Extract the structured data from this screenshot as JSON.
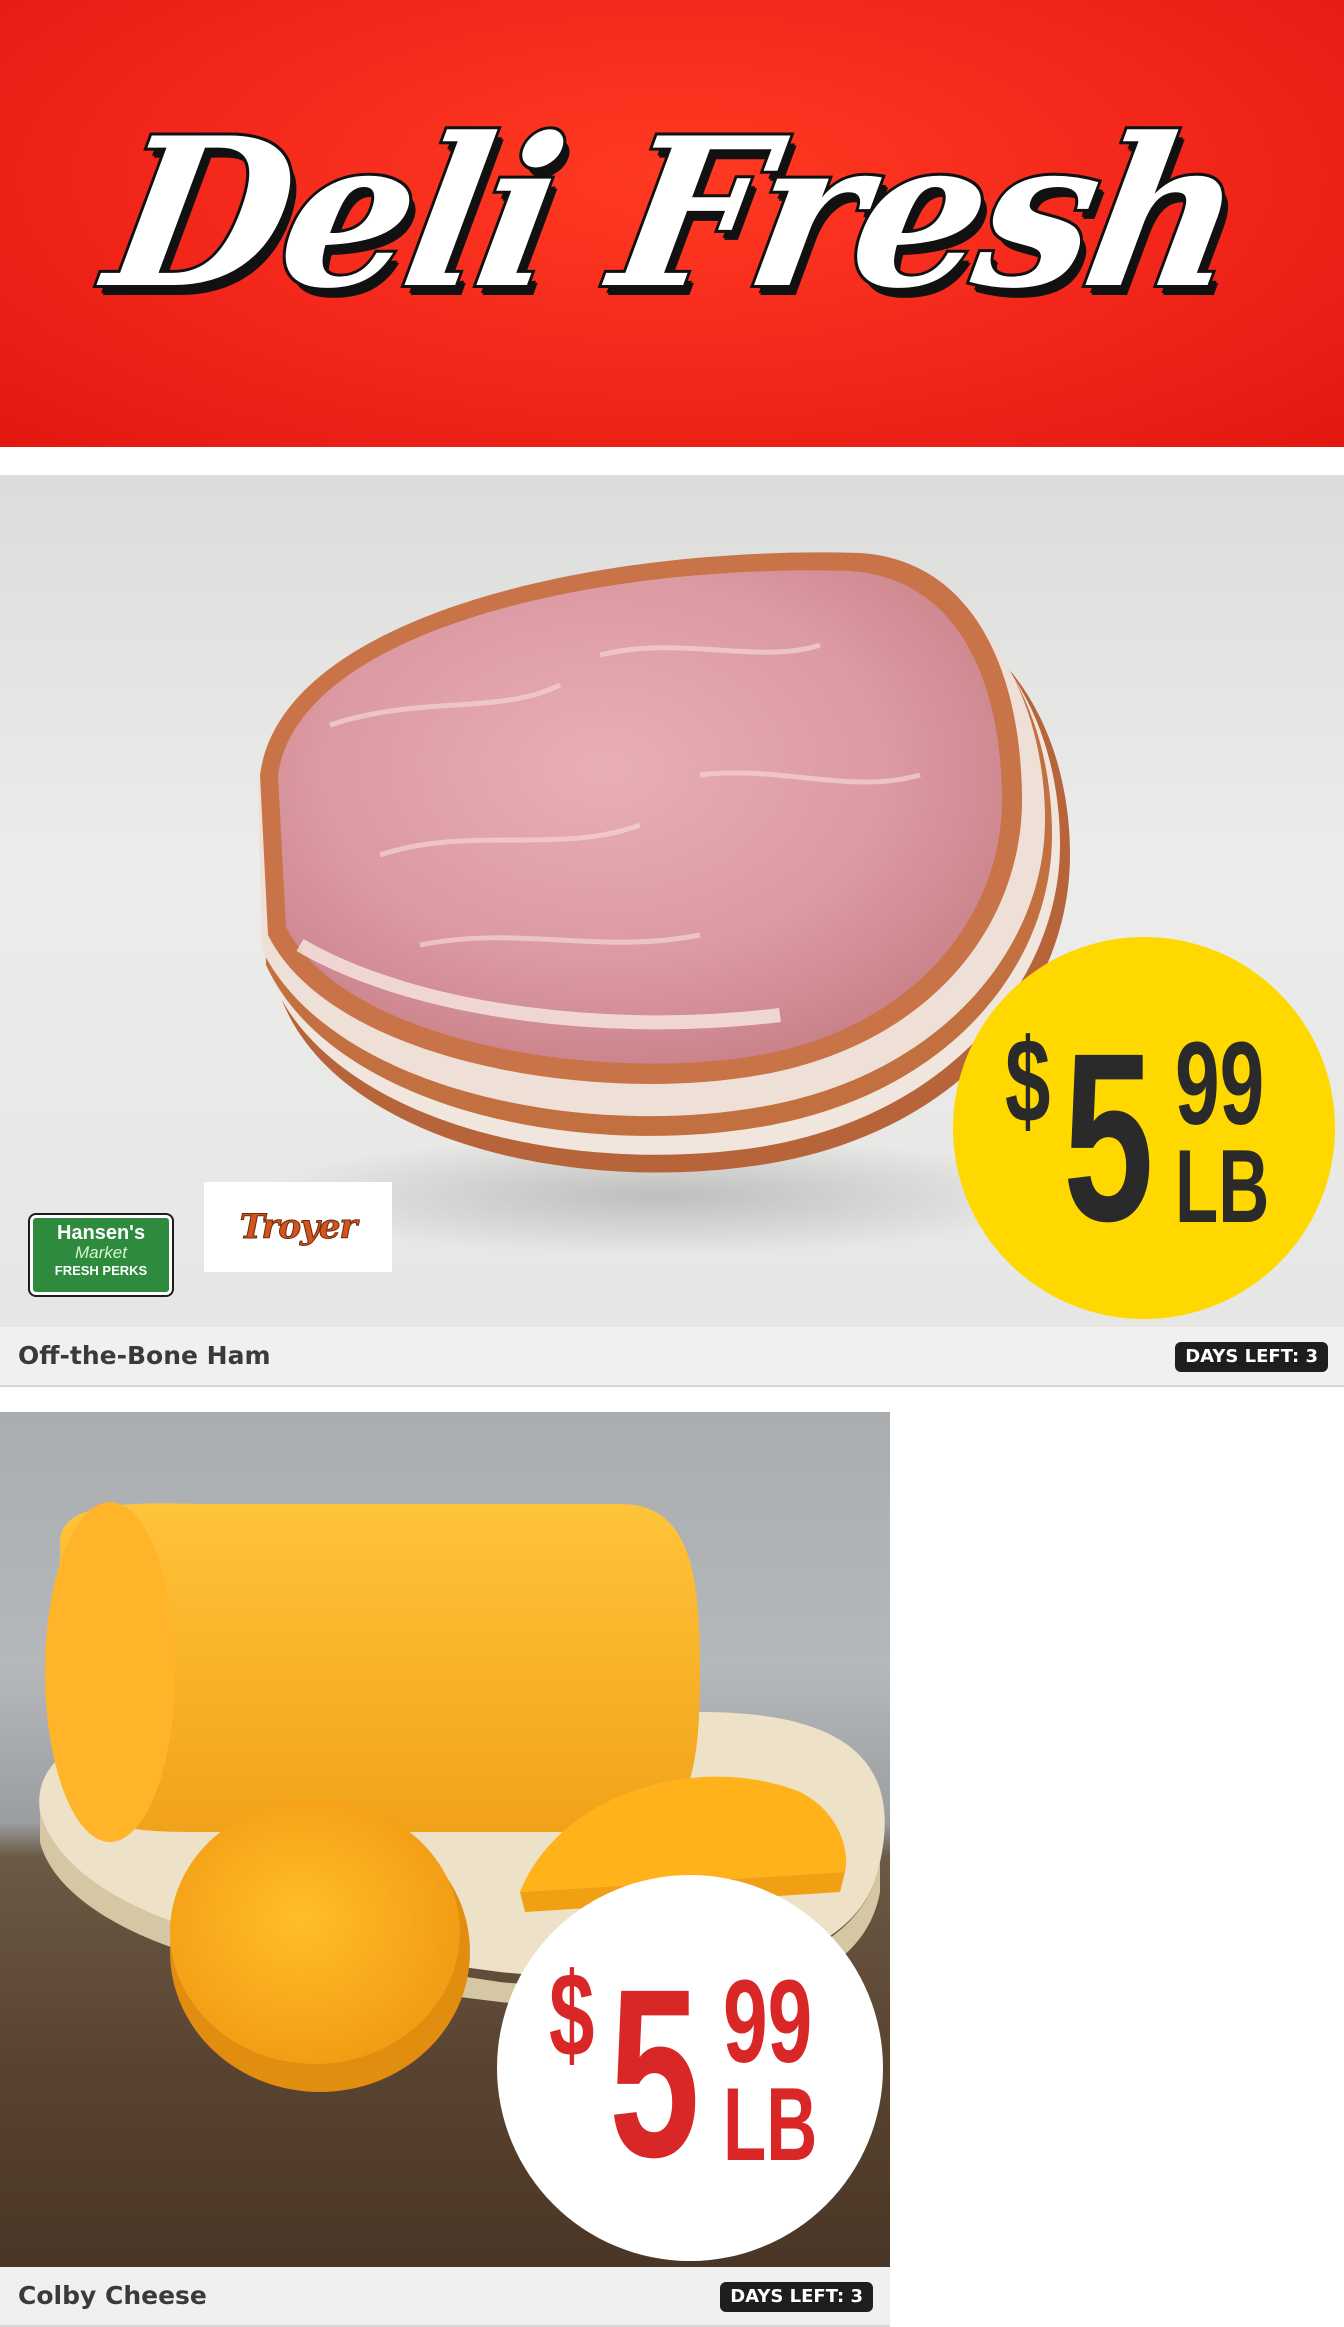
{
  "header": {
    "title": "Deli Fresh",
    "background_color": "#f2261a"
  },
  "products": [
    {
      "name": "Off-the-Bone Ham",
      "days_left": "DAYS LEFT: 3",
      "price": {
        "currency": "$",
        "whole": "5",
        "cents": "99",
        "unit": "LB"
      },
      "bubble_color": "#ffd800",
      "price_text_color": "#2a2a2a",
      "logos": [
        {
          "name": "hansens-market-fresh-perks-logo",
          "line1": "Hansen's",
          "line2": "Market",
          "line3": "FRESH PERKS"
        },
        {
          "name": "troyer-logo",
          "text": "Troyer"
        }
      ],
      "image": "sliced-ham-photo"
    },
    {
      "name": "Colby Cheese",
      "days_left": "DAYS LEFT: 3",
      "price": {
        "currency": "$",
        "whole": "5",
        "cents": "99",
        "unit": "LB"
      },
      "bubble_color": "#ffffff",
      "price_text_color": "#d92626",
      "image": "colby-cheese-photo"
    }
  ]
}
